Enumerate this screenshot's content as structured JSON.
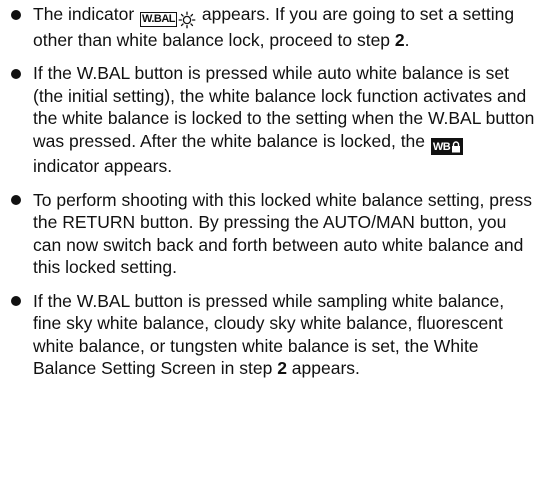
{
  "bullets": [
    {
      "p1": "The indicator",
      "indicator_text": "W.BAL",
      "p2": " appears. If you are going to set a setting other than white balance lock, proceed to step ",
      "step": "2",
      "p3": "."
    },
    {
      "p1": "If the W.BAL button is pressed while auto white balance is set (the initial setting), the white balance lock function activates and the white balance is locked to the setting when the W.BAL button was pressed. After the white balance is locked, the",
      "indicator_text": "WB",
      "p2": " indicator appears."
    },
    {
      "text": "To perform shooting with this locked white balance setting, press the RETURN button. By pressing the AUTO/MAN button, you can now switch back and forth between auto white balance and this locked setting."
    },
    {
      "p1": "If the W.BAL button is pressed while sampling white balance, fine sky white balance, cloudy sky white balance, fluorescent white balance, or tungsten white balance is set, the White Balance Setting Screen in step ",
      "step": "2",
      "p2": " appears."
    }
  ],
  "icons": {
    "wbal_indicator": "wbal-sun-icon",
    "lock_indicator": "wb-lock-icon"
  }
}
